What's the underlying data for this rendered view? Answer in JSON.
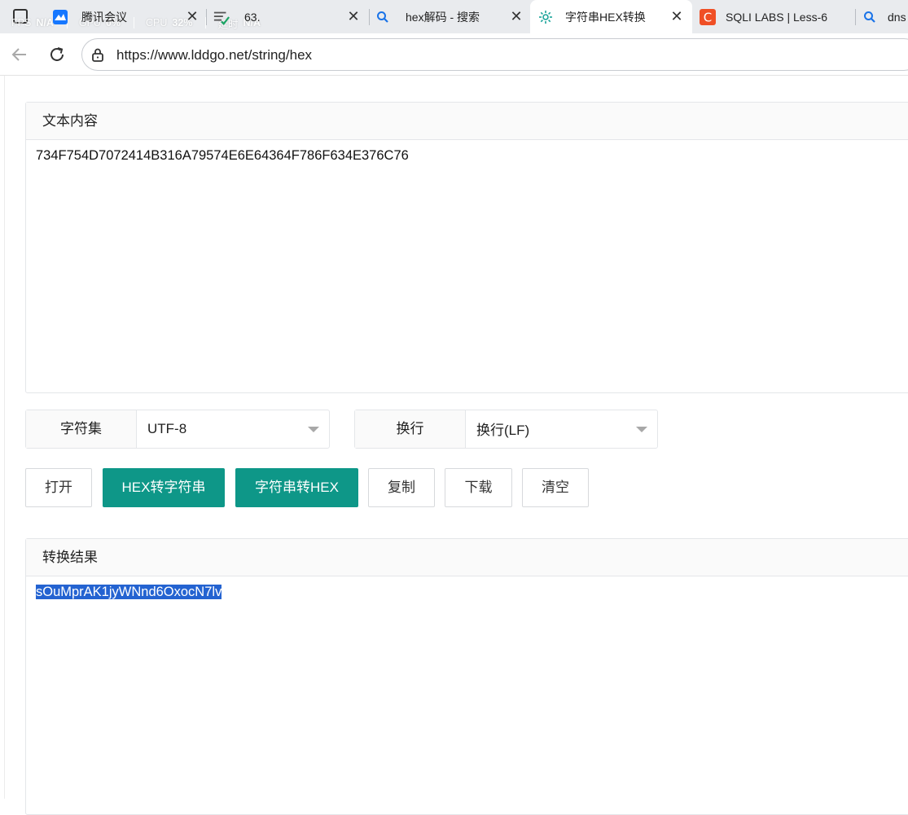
{
  "perf_overlay": {
    "fps_label": "FPS",
    "fps_value": "N/A",
    "gpu_label": "GPU",
    "gpu_value": "0%",
    "cpu_label": "CPU",
    "cpu_value": "32%",
    "latency_label": "延时",
    "latency_value": "N/A"
  },
  "tabs": [
    {
      "title": "腾讯会议",
      "icon": "tencent-meeting-icon"
    },
    {
      "title": "63.",
      "icon": "checklist-icon"
    },
    {
      "title": "hex解码 - 搜索",
      "icon": "search-icon"
    },
    {
      "title": "字符串HEX转换",
      "icon": "gear-icon",
      "active": true
    },
    {
      "title": "SQLI LABS | Less-6",
      "icon": "c-logo-icon"
    },
    {
      "title": "dns",
      "icon": "search-icon"
    }
  ],
  "address_bar": {
    "url": "https://www.lddgo.net/string/hex"
  },
  "input_panel": {
    "title": "文本内容",
    "content": "734F754D7072414B316A79574E6E64364F786F634E376C76"
  },
  "options": {
    "charset_label": "字符集",
    "charset_value": "UTF-8",
    "newline_label": "换行",
    "newline_value": "换行(LF)"
  },
  "buttons": {
    "open": "打开",
    "hex_to_string": "HEX转字符串",
    "string_to_hex": "字符串转HEX",
    "copy": "复制",
    "download": "下载",
    "clear": "清空"
  },
  "output_panel": {
    "title": "转换结果",
    "content": "sOuMprAK1jyWNnd6OxocN7lv"
  },
  "colors": {
    "primary": "#0e9788",
    "selection": "#2463d1"
  }
}
